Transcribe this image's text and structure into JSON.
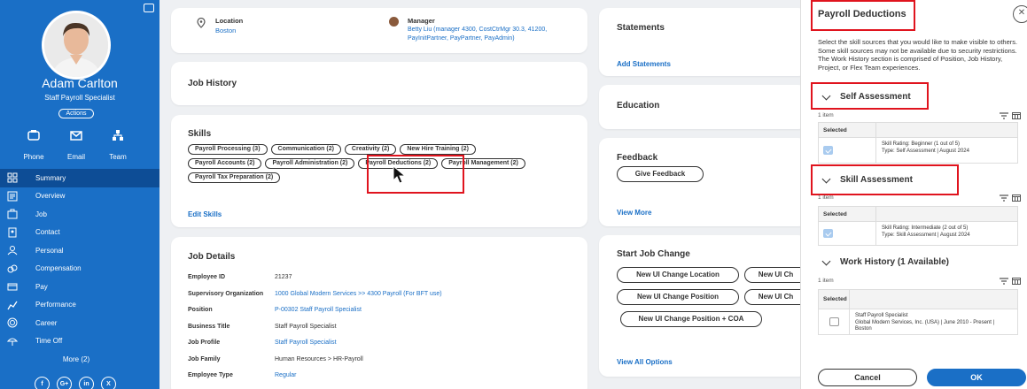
{
  "sidebar": {
    "name": "Adam Carlton",
    "title": "Staff Payroll Specialist",
    "actions": "Actions",
    "quick": [
      {
        "label": "Phone",
        "icon": "phone-icon"
      },
      {
        "label": "Email",
        "icon": "email-icon"
      },
      {
        "label": "Team",
        "icon": "team-icon"
      }
    ],
    "nav": [
      {
        "label": "Summary",
        "icon": "summary-icon",
        "active": true
      },
      {
        "label": "Overview",
        "icon": "overview-icon"
      },
      {
        "label": "Job",
        "icon": "job-icon"
      },
      {
        "label": "Contact",
        "icon": "contact-icon"
      },
      {
        "label": "Personal",
        "icon": "personal-icon"
      },
      {
        "label": "Compensation",
        "icon": "compensation-icon"
      },
      {
        "label": "Pay",
        "icon": "pay-icon"
      },
      {
        "label": "Performance",
        "icon": "performance-icon"
      },
      {
        "label": "Career",
        "icon": "career-icon"
      },
      {
        "label": "Time Off",
        "icon": "time-off-icon"
      }
    ],
    "more": "More (2)",
    "social": [
      "f",
      "G+",
      "in",
      "X"
    ]
  },
  "top_card": {
    "location_label": "Location",
    "location_value": "Boston",
    "manager_label": "Manager",
    "manager_value_1": "Betty Liu (manager 4300, CostCtrMgr 30.3, 41200,",
    "manager_value_2": "PayInitPartner, PayPartner, PayAdmin)"
  },
  "job_history": {
    "title": "Job History"
  },
  "skills": {
    "title": "Skills",
    "rows": [
      [
        "Payroll Processing (3)",
        "Communication (2)",
        "Creativity (2)",
        "New Hire Training (2)"
      ],
      [
        "Payroll Accounts (2)",
        "Payroll Administration (2)",
        "Payroll Deductions (2)",
        "Payroll Management (2)"
      ],
      [
        "Payroll Tax Preparation (2)"
      ]
    ],
    "edit": "Edit Skills"
  },
  "job_details": {
    "title": "Job Details",
    "rows": [
      {
        "label": "Employee ID",
        "value": "21237",
        "link": false
      },
      {
        "label": "Supervisory Organization",
        "value": "1000 Global Modern Services >> 4300 Payroll (For BFT use)",
        "link": true
      },
      {
        "label": "Position",
        "value": "P-00302 Staff Payroll Specialist",
        "link": true
      },
      {
        "label": "Business Title",
        "value": "Staff Payroll Specialist",
        "link": false
      },
      {
        "label": "Job Profile",
        "value": "Staff Payroll Specialist",
        "link": true
      },
      {
        "label": "Job Family",
        "value": "Human Resources > HR-Payroll",
        "link": false
      },
      {
        "label": "Employee Type",
        "value": "Regular",
        "link": true
      }
    ]
  },
  "statements": {
    "title": "Statements",
    "add": "Add Statements"
  },
  "education": {
    "title": "Education"
  },
  "feedback": {
    "title": "Feedback",
    "give": "Give Feedback",
    "view_more": "View More"
  },
  "job_change": {
    "title": "Start Job Change",
    "buttons": [
      "New UI Change Location",
      "New UI Ch",
      "New UI Change Position",
      "New UI Ch",
      "New UI Change Position + COA"
    ],
    "view_all": "View All Options"
  },
  "panel": {
    "title": "Payroll Deductions",
    "description": "Select the skill sources that you would like to make visible to others. Some skill sources may not be available due to security restrictions. The Work History section is comprised of Position, Job History, Project, or Flex Team experiences.",
    "self": {
      "title": "Self Assessment",
      "count": "1 item",
      "col": "Selected",
      "line1": "Skill Rating: Beginner (1 out of 5)",
      "line2": "Type: Self Assessment | August 2024"
    },
    "skill": {
      "title": "Skill Assessment",
      "count": "1 item",
      "col": "Selected",
      "line1": "Skill Rating: Intermediate (2 out of 5)",
      "line2": "Type: Skill Assessment | August 2024"
    },
    "work": {
      "title": "Work History (1 Available)",
      "count": "1 item",
      "col": "Selected",
      "line1": "Staff Payroll Specialist",
      "line2": "Global Modern Services, Inc. (USA) | June 2010 - Present |",
      "line3": "Boston"
    },
    "cancel": "Cancel",
    "ok": "OK"
  }
}
